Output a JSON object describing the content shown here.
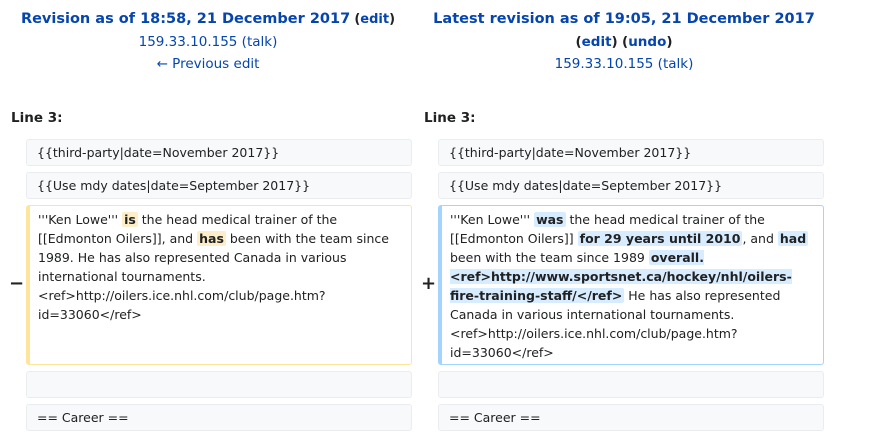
{
  "left_header": {
    "title": "Revision as of 18:58, 21 December 2017",
    "edit_label": "edit",
    "user": "159.33.10.155",
    "talk_label": "talk",
    "prev_edit_label": "← Previous edit"
  },
  "right_header": {
    "title": "Latest revision as of 19:05, 21 December 2017",
    "edit_label": "edit",
    "undo_label": "undo",
    "user": "159.33.10.155",
    "talk_label": "talk"
  },
  "line_label": "Line 3:",
  "context": {
    "third_party": "{{third-party|date=November 2017}}",
    "mdy_dates": "{{Use mdy dates|date=September 2017}}",
    "career": "== Career =="
  },
  "markers": {
    "deleted": "−",
    "added": "+"
  },
  "deleted_line": {
    "p1": "'''Ken Lowe''' ",
    "w1": "is",
    "p2": " the head medical trainer of the [[Edmonton Oilers]], and ",
    "w2": "has",
    "p3": " been with the team since 1989. He has also represented Canada in various international tournaments.<ref>http://oilers.ice.nhl.com/club/page.htm?id=33060</ref>"
  },
  "added_line": {
    "p1": "'''Ken Lowe''' ",
    "w1": "was",
    "p2": " the head medical trainer of the [[Edmonton Oilers]] ",
    "w2": "for 29 years until 2010",
    "p3": ", and ",
    "w3": "had",
    "p4": " been with the team since 1989 ",
    "w4": "overall. <ref>http://www.sportsnet.ca/hockey/nhl/oilers-fire-training-staff/</ref>",
    "p5": " He has also represented Canada in various international tournaments. <ref>http://oilers.ice.nhl.com/club/page.htm?id=33060</ref>"
  }
}
